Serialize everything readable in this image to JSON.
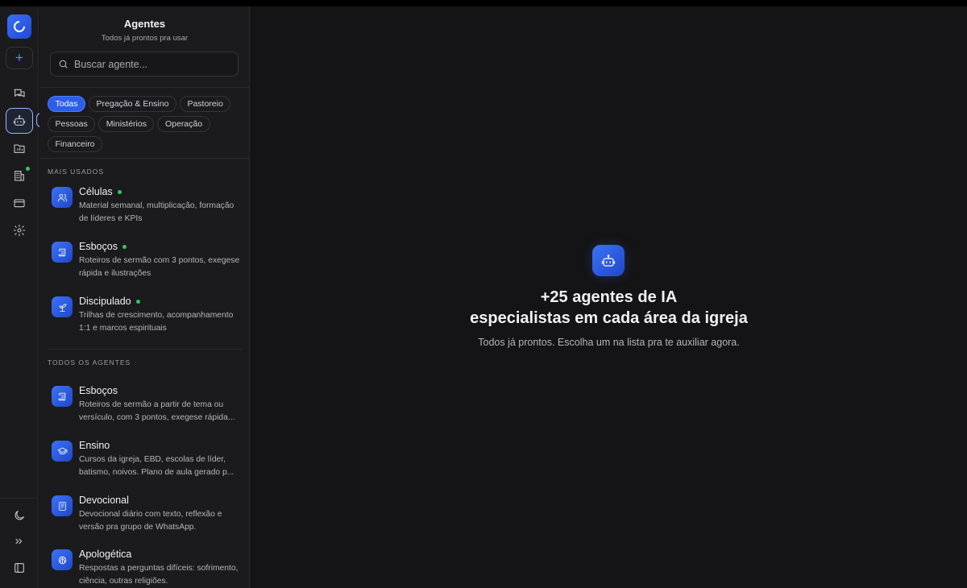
{
  "panel": {
    "title": "Agentes",
    "subtitle": "Todos já prontos pra usar",
    "search_placeholder": "Buscar agente..."
  },
  "rail": {
    "items": [
      "chat-icon",
      "robot-icon",
      "folder-chart-icon",
      "building-icon",
      "card-icon",
      "settings-icon"
    ],
    "bottom": [
      "moon-icon",
      "chevrons-right-icon",
      "sidebar-toggle-icon"
    ]
  },
  "filters": [
    {
      "label": "Todas",
      "active": true
    },
    {
      "label": "Pregação & Ensino",
      "active": false
    },
    {
      "label": "Pastoreio",
      "active": false
    },
    {
      "label": "Pessoas",
      "active": false
    },
    {
      "label": "Ministérios",
      "active": false
    },
    {
      "label": "Operação",
      "active": false
    },
    {
      "label": "Financeiro",
      "active": false
    }
  ],
  "sections": {
    "most_used": "MAIS USADOS",
    "all_agents": "TODOS OS AGENTES"
  },
  "most_used": [
    {
      "name": "Células",
      "desc": "Material semanal, multiplicação, formação de líderes e KPIs",
      "icon": "people-icon",
      "online": true
    },
    {
      "name": "Esboços",
      "desc": "Roteiros de sermão com 3 pontos, exegese rápida e ilustrações",
      "icon": "scroll-icon",
      "online": true
    },
    {
      "name": "Discipulado",
      "desc": "Trilhas de crescimento, acompanhamento 1:1 e marcos espirituais",
      "icon": "sprout-icon",
      "online": true
    }
  ],
  "all_agents": [
    {
      "name": "Esboços",
      "desc": "Roteiros de sermão a partir de tema ou versículo, com 3 pontos, exegese rápida...",
      "icon": "scroll-icon"
    },
    {
      "name": "Ensino",
      "desc": "Cursos da igreja, EBD, escolas de líder, batismo, noivos. Plano de aula gerado p...",
      "icon": "graduation-cap-icon"
    },
    {
      "name": "Devocional",
      "desc": "Devocional diário com texto, reflexão e versão pra grupo de WhatsApp.",
      "icon": "book-icon"
    },
    {
      "name": "Apologética",
      "desc": "Respostas a perguntas difíceis: sofrimento, ciência, outras religiões.",
      "icon": "brain-icon"
    }
  ],
  "hero": {
    "line1": "+25 agentes de IA",
    "line2": "especialistas em cada área da igreja",
    "subtitle": "Todos já prontos. Escolha um na lista pra te auxiliar agora."
  },
  "colors": {
    "accent": "#2c5ee8",
    "online": "#34c759",
    "background": "#141416",
    "panel": "#1b1b1e"
  }
}
